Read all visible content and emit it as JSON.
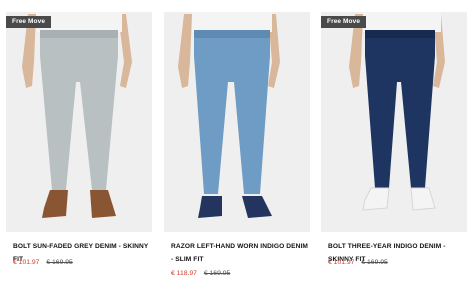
{
  "products": [
    {
      "badge": "Free Move",
      "name": "BOLT SUN-FADED GREY DENIM - SKINNY FIT",
      "sale_price": "€ 101.97",
      "original_price": "€ 169.95",
      "jeans_color": "#b9c0c2",
      "shoe_color": "#8a5532"
    },
    {
      "badge": "",
      "name": "RAZOR LEFT-HAND WORN INDIGO DENIM - SLIM FIT",
      "sale_price": "€ 118.97",
      "original_price": "€ 169.95",
      "jeans_color": "#6f9cc4",
      "shoe_color": "#23355e"
    },
    {
      "badge": "Free Move",
      "name": "BOLT THREE-YEAR INDIGO DENIM - SKINNY FIT",
      "sale_price": "€ 101.97",
      "original_price": "€ 169.95",
      "jeans_color": "#1f3561",
      "shoe_color": "#f4f4f4"
    }
  ],
  "colors": {
    "badge_bg": "#4a4a4a",
    "sale_price": "#d23a2d",
    "image_bg": "#efefef"
  }
}
